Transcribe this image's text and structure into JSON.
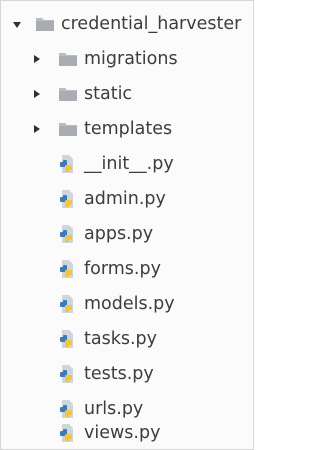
{
  "tree": {
    "root": {
      "label": "credential_harvester",
      "icon": "folder-icon",
      "expanded": true
    },
    "folders": [
      {
        "label": "migrations",
        "icon": "folder-icon",
        "expanded": false
      },
      {
        "label": "static",
        "icon": "folder-icon",
        "expanded": false
      },
      {
        "label": "templates",
        "icon": "folder-icon",
        "expanded": false
      }
    ],
    "files": [
      {
        "label": "__init__.py",
        "icon": "python-file-icon"
      },
      {
        "label": "admin.py",
        "icon": "python-file-icon"
      },
      {
        "label": "apps.py",
        "icon": "python-file-icon"
      },
      {
        "label": "forms.py",
        "icon": "python-file-icon"
      },
      {
        "label": "models.py",
        "icon": "python-file-icon"
      },
      {
        "label": "tasks.py",
        "icon": "python-file-icon"
      },
      {
        "label": "tests.py",
        "icon": "python-file-icon"
      },
      {
        "label": "urls.py",
        "icon": "python-file-icon"
      },
      {
        "label": "views.py",
        "icon": "python-file-icon"
      }
    ]
  },
  "colors": {
    "text": "#3d3d3d",
    "folder": "#b9bcc0",
    "python_blue": "#3d7ab8",
    "python_yellow": "#f2c53d",
    "file_page": "#cfd5dc"
  }
}
